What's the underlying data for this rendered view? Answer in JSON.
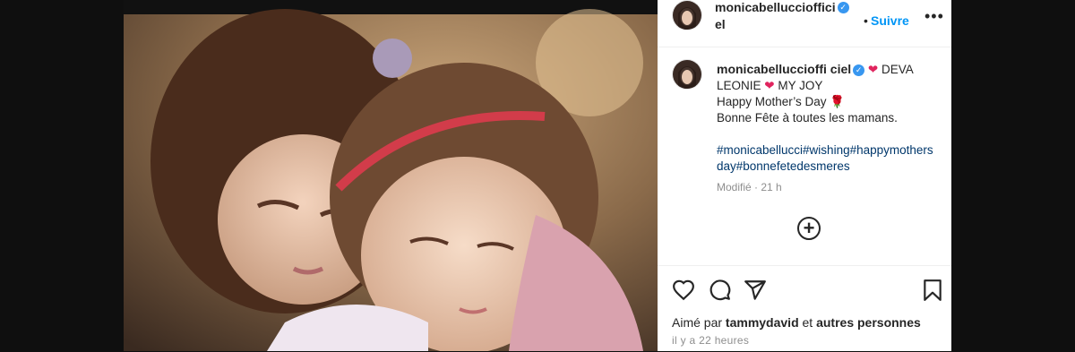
{
  "post": {
    "author": "monicabelluccio­fficiel",
    "author_full": "monicabelluccioffici el",
    "follow_label": "Suivre",
    "more_label": "•••"
  },
  "caption": {
    "author": "monicabelluccioffi ciel",
    "line1_a": "DEVA",
    "line1_b": "LEONIE",
    "line1_c": "MY JOY",
    "line2": "Happy Mother’s Day",
    "line3": "Bonne Fête à toutes les mamans.",
    "hashtags": "#monicabellucci#wishing#happymothersday#bonnefetedesmeres",
    "edited": "Modifié",
    "time_ago": "21 h"
  },
  "engagement": {
    "liked_by_prefix": "Aimé par",
    "liked_by_user": "tammydavid",
    "liked_by_mid": "et",
    "liked_by_others": "autres personnes",
    "posted_time": "il y a 22 heures"
  },
  "colors": {
    "accent": "#0095f6",
    "verified": "#3897f0",
    "hashtag": "#00376b",
    "heart": "#e0245e"
  },
  "icons": {
    "like": "heart-outline-icon",
    "comment": "speech-bubble-icon",
    "share": "paper-plane-icon",
    "save": "bookmark-icon",
    "add_comment": "plus-circle-icon",
    "rose": "rose-icon"
  }
}
